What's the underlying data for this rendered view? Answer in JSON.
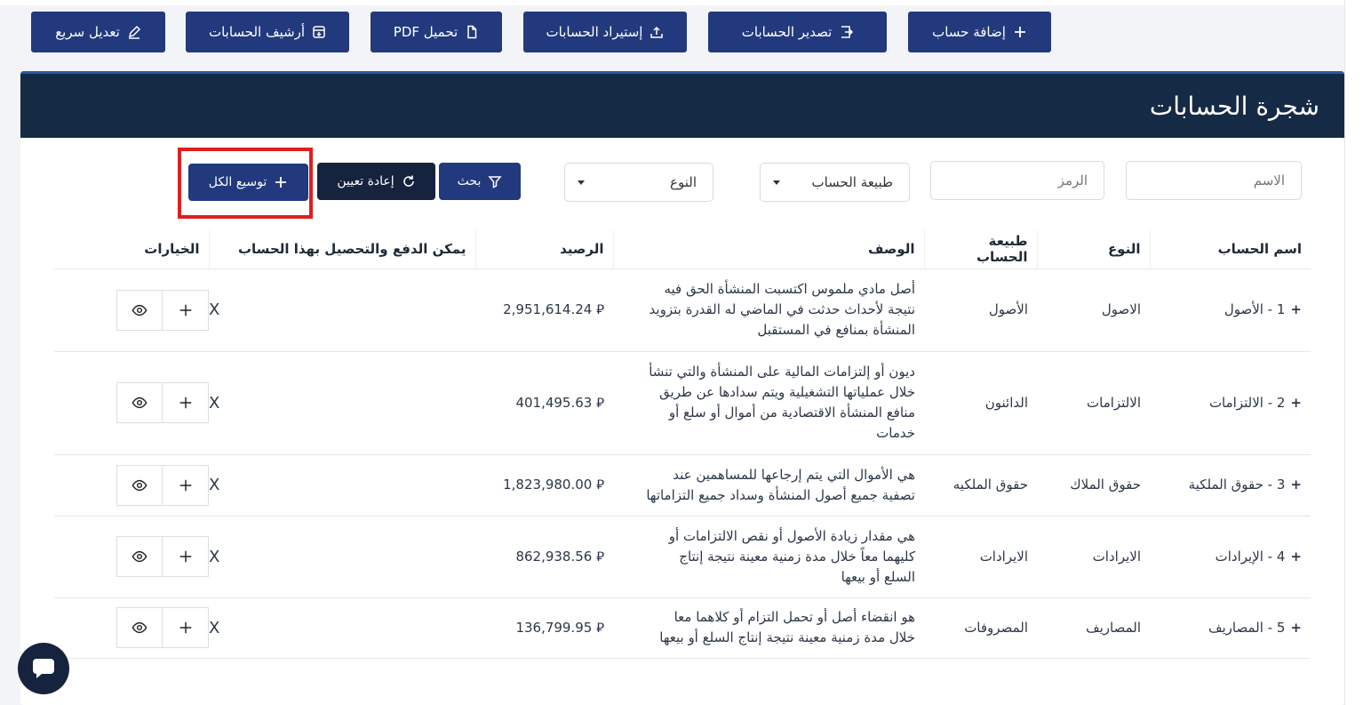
{
  "toolbar": {
    "add_account": "إضافة حساب",
    "export_accounts": "تصدير الحسابات",
    "import_accounts": "إستيراد الحسابات",
    "download_pdf": "تحميل PDF",
    "archive_accounts": "أرشيف الحسابات",
    "quick_edit": "تعديل سريع"
  },
  "card": {
    "title": "شجرة الحسابات"
  },
  "filters": {
    "name_placeholder": "الاسم",
    "code_placeholder": "الرمز",
    "nature_select": "طبيعة الحساب",
    "type_select": "النوع",
    "search_button": "بحث",
    "reset_button": "إعادة تعيين",
    "expand_all_button": "توسيع الكل"
  },
  "table": {
    "headers": {
      "account_name": "اسم الحساب",
      "type": "النوع",
      "nature": "طبيعة الحساب",
      "description": "الوصف",
      "balance": "الرصيد",
      "payable": "يمكن الدفع والتحصيل بهذا الحساب",
      "options": "الخيارات"
    },
    "rows": [
      {
        "name": "1 - الأصول",
        "type": "الاصول",
        "nature": "الأصول",
        "desc": [
          "أصل مادي ملموس اكتسبت المنشأة الحق فيه",
          "نتيجة لأحداث حدثت في الماضي له القدرة بتزويد",
          "المنشأة بمنافع في المستقبل"
        ],
        "balance": "2,951,614.24 ⃁",
        "payable": "X"
      },
      {
        "name": "2 - الالتزامات",
        "type": "الالتزامات",
        "nature": "الدائنون",
        "desc": [
          "ديون أو إلتزامات المالية على المنشأة والتي تنشأ",
          "خلال عملياتها التشغيلية ويتم سدادها عن طريق",
          "منافع المنشأة الاقتصادية من أموال أو سلع أو",
          "خدمات"
        ],
        "balance": "401,495.63 ⃁",
        "payable": "X"
      },
      {
        "name": "3 - حقوق الملكية",
        "type": "حقوق الملاك",
        "nature": "حقوق الملكيه",
        "desc": [
          "هي الأموال التي يتم إرجاعها للمساهمين عند",
          "تصفية جميع أصول المنشأة وسداد جميع التزاماتها"
        ],
        "balance": "1,823,980.00 ⃁",
        "payable": "X"
      },
      {
        "name": "4 - الإيرادات",
        "type": "الايرادات",
        "nature": "الايرادات",
        "desc": [
          "هي مقدار زيادة الأصول أو نقص الالتزامات أو",
          "كليهما معاً خلال مدة زمنية معينة نتيجة إنتاج",
          "السلع أو بيعها"
        ],
        "balance": "862,938.56 ⃁",
        "payable": "X"
      },
      {
        "name": "5 - المصاريف",
        "type": "المصاريف",
        "nature": "المصروفات",
        "desc": [
          "هو انقضاء أصل أو تحمل التزام أو كلاهما معا",
          "خلال مدة زمنية معينة نتيجة إنتاج السلع أو بيعها"
        ],
        "balance": "136,799.95 ⃁",
        "payable": "X"
      }
    ]
  },
  "colors": {
    "primary": "#22397d",
    "header": "#152a45",
    "dark_button": "#15233f",
    "highlight": "#e01e1e"
  }
}
